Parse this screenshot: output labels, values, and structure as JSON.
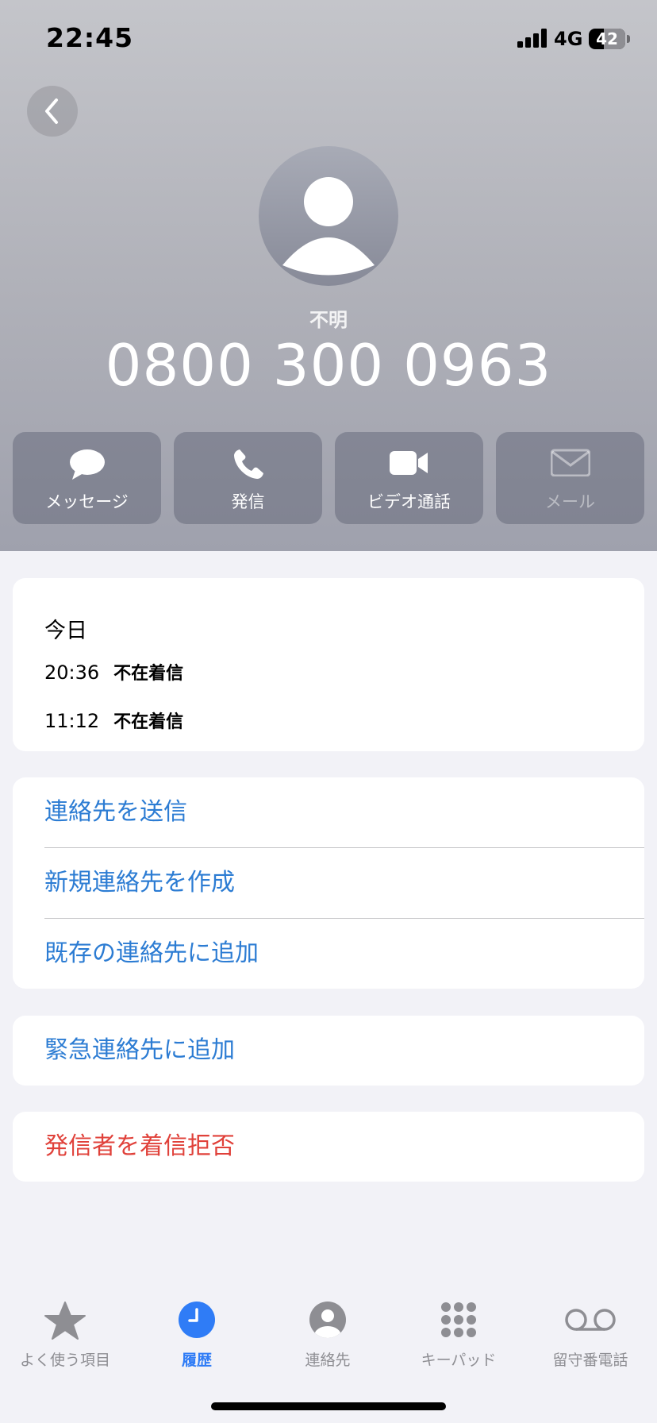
{
  "status_bar": {
    "time": "22:45",
    "network": "4G",
    "battery": "42",
    "battery_level_percent": 42
  },
  "contact": {
    "label": "不明",
    "number": "0800 300 0963"
  },
  "actions": [
    {
      "label": "メッセージ",
      "icon": "message-bubble-icon",
      "enabled": true
    },
    {
      "label": "発信",
      "icon": "phone-icon",
      "enabled": true
    },
    {
      "label": "ビデオ通話",
      "icon": "video-camera-icon",
      "enabled": true
    },
    {
      "label": "メール",
      "icon": "envelope-icon",
      "enabled": false
    }
  ],
  "call_history": {
    "title": "今日",
    "calls": [
      {
        "time": "20:36",
        "kind": "不在着信"
      },
      {
        "time": "11:12",
        "kind": "不在着信"
      }
    ]
  },
  "contact_options": {
    "items": [
      "連絡先を送信",
      "新規連絡先を作成",
      "既存の連絡先に追加"
    ]
  },
  "emergency": {
    "label": "緊急連絡先に追加"
  },
  "block": {
    "label": "発信者を着信拒否"
  },
  "tabs": [
    {
      "label": "よく使う項目",
      "icon": "star-icon",
      "active": false
    },
    {
      "label": "履歴",
      "icon": "clock-icon",
      "active": true
    },
    {
      "label": "連絡先",
      "icon": "person-circle-icon",
      "active": false
    },
    {
      "label": "キーパッド",
      "icon": "keypad-icon",
      "active": false
    },
    {
      "label": "留守番電話",
      "icon": "voicemail-icon",
      "active": false
    }
  ],
  "colors": {
    "link_blue": "#2c7cd3",
    "destructive_red": "#e0413a",
    "tab_active": "#2f7cf6",
    "tab_inactive": "#8e8e93"
  }
}
